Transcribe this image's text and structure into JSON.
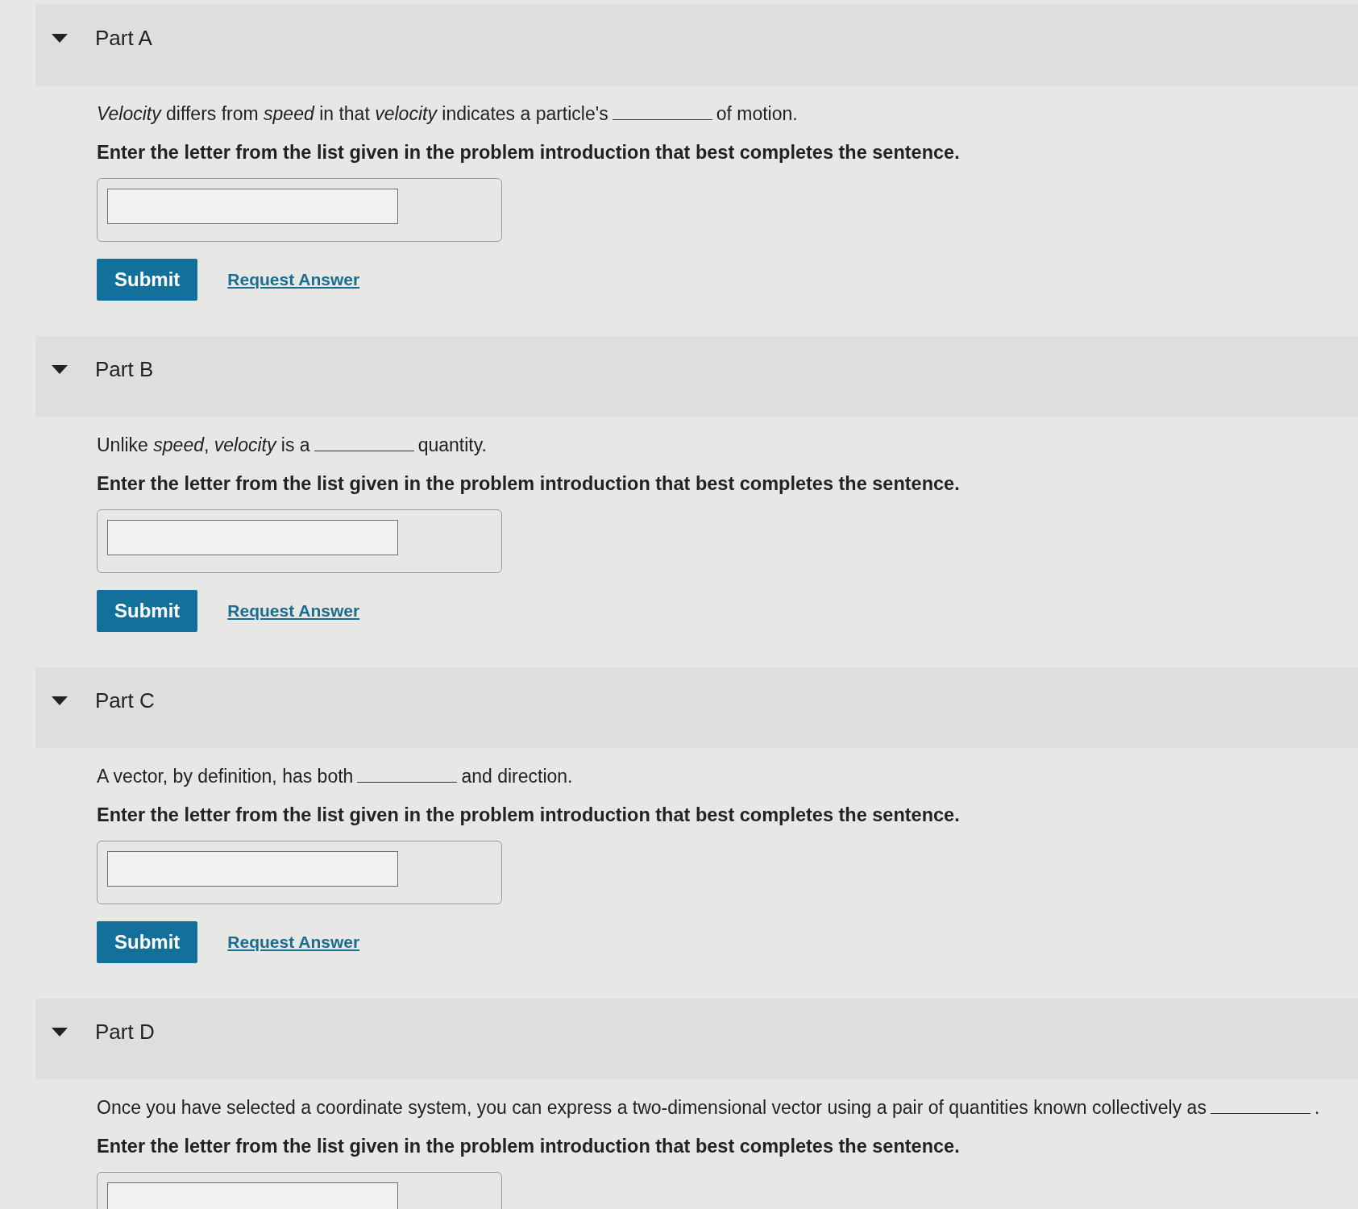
{
  "parts": [
    {
      "title": "Part A",
      "expanded": true,
      "question": {
        "before": "*Velocity* differs from *speed* in that *velocity* indicates a particle's",
        "after": "of motion."
      },
      "instruction": "Enter the letter from the list given in the problem introduction that best completes the sentence.",
      "buttons": {
        "submit": "Submit",
        "request": "Request Answer"
      }
    },
    {
      "title": "Part B",
      "expanded": true,
      "question": {
        "before": "Unlike *speed*, *velocity* is a",
        "after": "quantity."
      },
      "instruction": "Enter the letter from the list given in the problem introduction that best completes the sentence.",
      "buttons": {
        "submit": "Submit",
        "request": "Request Answer"
      }
    },
    {
      "title": "Part C",
      "expanded": true,
      "question": {
        "before": "A vector, by definition, has both",
        "after": "and direction."
      },
      "instruction": "Enter the letter from the list given in the problem introduction that best completes the sentence.",
      "buttons": {
        "submit": "Submit",
        "request": "Request Answer"
      }
    },
    {
      "title": "Part D",
      "expanded": true,
      "question": {
        "before": "Once you have selected a coordinate system, you can express a two-dimensional vector using a pair of quantities known collectively as",
        "after": "."
      },
      "instruction": "Enter the letter from the list given in the problem introduction that best completes the sentence."
    }
  ]
}
